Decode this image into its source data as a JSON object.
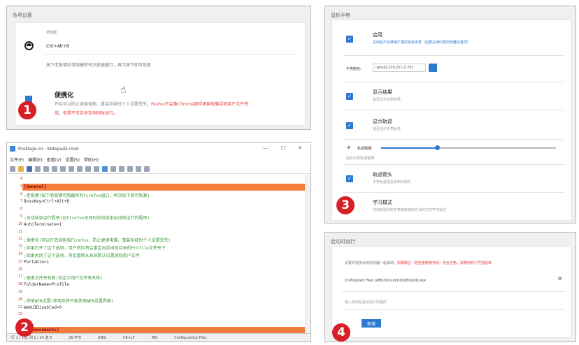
{
  "panel1": {
    "title": "杂项设置",
    "hotkey_label": "老板键:",
    "hotkey_value": "Ctrl+Alt+B",
    "hotkey_desc": "按下老板键后可隐藏所有浏览器窗口，再次按下即可恢复",
    "portable_title": "便携化",
    "portable_desc_1": "开启可以防止更换电脑、重装系统时个人设置丢失。",
    "portable_desc_red_1": "Firefox不会像Chrome那样更换电脑导致用户文件失",
    "portable_desc_red_2": "效。但是不支持多实例同时运行。",
    "badge": "1"
  },
  "panel2": {
    "window_title": "FireDoge.ini - Notepad2-mod",
    "menu": [
      "文件(F)",
      "编辑(E)",
      "查看(V)",
      "设置(S)",
      "帮助(H)"
    ],
    "lines": [
      {
        "n": "4",
        "t": ""
      },
      {
        "n": "5",
        "t": "[General]",
        "type": "section"
      },
      {
        "n": "6",
        "t": ";老板键(按下老板键可隐藏所有Firefox窗口，再次按下即可恢复)",
        "type": "comment"
      },
      {
        "n": "7",
        "t": "BossKey=Ctrl+Alt+B"
      },
      {
        "n": "8",
        "t": ""
      },
      {
        "n": "9",
        "t": ";自动结束运行程序(在Firefox关闭时自动结束启动时运行的程序)",
        "type": "comment"
      },
      {
        "n": "10",
        "t": "AutoTerminate=1"
      },
      {
        "n": "11",
        "t": ""
      },
      {
        "n": "12",
        "t": ";便携化(可以打造绿色版Firefox，防止更换电脑、重装系统时个人设置丢失)",
        "type": "comment"
      },
      {
        "n": "13",
        "t": ";如果打开了这个选项，用户资料将会重定向到当前目录的Profile文件夹下",
        "type": "comment"
      },
      {
        "n": "14",
        "t": ";如果关闭了这个选项，将会重新从系统默认位置读取用户文件",
        "type": "comment"
      },
      {
        "n": "15",
        "t": "Portable=1"
      },
      {
        "n": "16",
        "t": ""
      },
      {
        "n": "17",
        "t": ";便携文件夹名称(自定义用户文件夹名称)",
        "type": "comment"
      },
      {
        "n": "18",
        "t": "FolderName=Profile"
      },
      {
        "n": "19",
        "t": ""
      },
      {
        "n": "20",
        "t": ";停用WEB设置(停用后将不能使用WEB设置界面)",
        "type": "comment"
      },
      {
        "n": "21",
        "t": "WebUIDisabled=0"
      },
      {
        "n": "22",
        "t": ""
      },
      {
        "n": "23",
        "t": ""
      },
      {
        "n": "24",
        "t": "[Enhancements]",
        "type": "section"
      }
    ],
    "status": [
      "行 1 / 101   列 1 / 14   选 0",
      "26 字节",
      "ANSI",
      "CR+LF",
      "INS",
      "Configuration Files"
    ],
    "badge": "2"
  },
  "panel3": {
    "title": "鼠标手势",
    "enable_title": "启用",
    "enable_desc": "关闭后不会使用扩展的鼠标手势（还要关闭内部浏览器设置项）",
    "color_label": "手势颜色:",
    "color_value": "rgba(0,139,251,0.70)",
    "show_result_title": "显示结果",
    "show_result_desc": "是否显示识别结果",
    "show_track_title": "显示轨迹",
    "show_track_desc": "是否显示手势轨迹",
    "track_width_label": "轨迹粗细:",
    "track_width_desc": "鼠标手势轨迹粗细",
    "track_width_fraction": 0.32,
    "arrow_title": "轨迹箭头",
    "arrow_desc": "手势轨迹是否绘制为箭头",
    "learn_title": "学习模式",
    "learn_desc": "自动的适应的手势高级使用方法的方式学习适应",
    "badge": "3"
  },
  "panel4": {
    "title": "启动时运行",
    "desc": "设置的程序会随浏览器一起启动，",
    "desc_red": "如果路径（包括金额用开始）包含空格，需要用双引号括起来",
    "path_value": "D:\\Program Files (x86)\\Tencent\\QQ\\Bin\\QQ.exe",
    "input_placeholder": "输入启动后自动运行的程序",
    "add_button": "新增",
    "badge": "4"
  },
  "colors": {
    "accent": "#2b79d1",
    "highlight": "#f47c3c",
    "badge": "#d81f26",
    "warning": "#e0403a"
  }
}
